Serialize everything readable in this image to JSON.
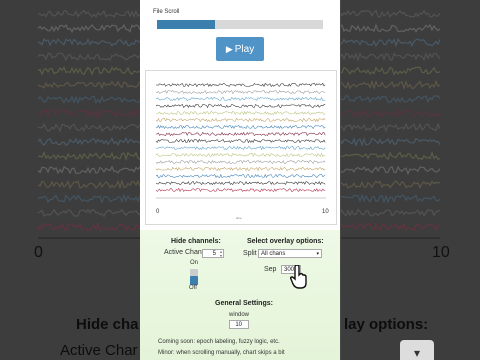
{
  "background": {
    "axis_ticks": [
      "0",
      "10"
    ],
    "heading_left": "Hide cha",
    "heading_right": "lay options:",
    "subtext_left": "Active Char"
  },
  "scroll": {
    "label": "File Scroll",
    "progress": 0.35
  },
  "play_button": {
    "label": "Play",
    "icon": "play-icon"
  },
  "chart_data": {
    "type": "line",
    "xlim": [
      0,
      10
    ],
    "x_ticks": [
      "0",
      "10"
    ],
    "xlabel": "time",
    "grid": false,
    "series_count": 16,
    "series_colors": [
      "#2b2b2b",
      "#9a9a9a",
      "#5aa0c8",
      "#2b2b2b",
      "#b7c27a",
      "#c0a060",
      "#3e7fb5",
      "#7a1f3a",
      "#2b2b2b",
      "#5aa0c8",
      "#b7c27a",
      "#9a9a9a",
      "#c0a060",
      "#3e7fb5",
      "#2b2b2b",
      "#b22a4a"
    ]
  },
  "controls": {
    "hide_channels_title": "Hide channels:",
    "active_chan_label": "Active Chan",
    "active_chan_value": "5",
    "toggle_on": "On",
    "toggle_off": "Off",
    "overlay_title": "Select overlay options:",
    "split_label": "Split",
    "split_value": "All chans",
    "sep_label": "Sep",
    "sep_value": "300",
    "general_title": "General Settings:",
    "window_label": "window",
    "window_value": "10",
    "note1": "Coming soon: epoch labeling, fuzzy logic, etc.",
    "note2": "Minor: when scrolling manually, chart skips a bit"
  }
}
